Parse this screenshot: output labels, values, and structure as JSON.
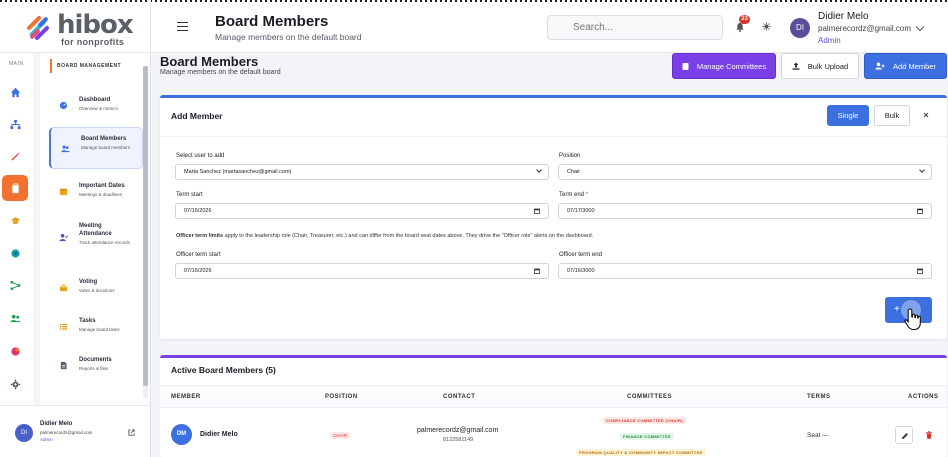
{
  "brand": {
    "name": "hibox",
    "tagline": "for nonprofits"
  },
  "header": {
    "title": "Board Members",
    "subtitle": "Manage members on the default board",
    "search_placeholder": "Search...",
    "notification_count": "33",
    "user": {
      "name": "Didier Melo",
      "email": "palmerecordz@gmail.com",
      "role": "Admin",
      "initials": "DI"
    }
  },
  "rail": {
    "label": "MAIN",
    "items": [
      "home-icon",
      "sitemap-icon",
      "rocket-icon",
      "clipboard-icon",
      "graduation-icon",
      "globe-icon",
      "network-icon",
      "users-icon",
      "chart-pie-icon",
      "gear-icon"
    ]
  },
  "sidebar": {
    "section": "BOARD MANAGEMENT",
    "items": [
      {
        "title": "Dashboard",
        "desc": "Overview & metrics"
      },
      {
        "title": "Board Members",
        "desc": "Manage board members"
      },
      {
        "title": "Important Dates",
        "desc": "Meetings & deadlines"
      },
      {
        "title": "Meeting Attendance",
        "desc": "Track attendance records"
      },
      {
        "title": "Voting",
        "desc": "Votes & decisions"
      },
      {
        "title": "Tasks",
        "desc": "Manage board tasks"
      },
      {
        "title": "Documents",
        "desc": "Reports & files"
      }
    ],
    "user": {
      "name": "Didier Melo",
      "email": "palmerecordz@gmail.com",
      "role": "Admin",
      "initials": "DI"
    }
  },
  "page": {
    "title": "Board Members",
    "subtitle": "Manage members on the default board",
    "actions": {
      "committees": "Manage Committees",
      "bulk_upload": "Bulk Upload",
      "add_member": "Add Member"
    }
  },
  "add_member": {
    "title": "Add Member",
    "mode_single": "Single",
    "mode_bulk": "Bulk",
    "select_user_label": "Select user to add",
    "select_user_value": "Marta Sanchez (martasanchez@gmail.com)",
    "position_label": "Position",
    "position_value": "Chair",
    "term_start_label": "Term start",
    "term_start_value": "07/16/2026",
    "term_end_label": "Term end",
    "term_end_required": "*",
    "term_end_value": "07/17/3000",
    "note_bold": "Officer term limits",
    "note_text": " apply to the leadership role (Chair, Treasurer, etc.) and can differ from the board seat dates above. They drive the \"Officer role\" alerts on the dashboard.",
    "officer_start_label": "Officer term start",
    "officer_start_value": "07/16/2026",
    "officer_end_label": "Officer term end",
    "officer_end_value": "07/16/3000",
    "save_label": "+"
  },
  "members": {
    "title": "Active Board Members (5)",
    "columns": [
      "MEMBER",
      "POSITION",
      "CONTACT",
      "COMMITTEES",
      "TERMS",
      "ACTIONS"
    ],
    "rows": [
      {
        "initials": "DM",
        "name": "Didier Melo",
        "position": "CHAIR",
        "email": "palmerecordz@gmail.com",
        "phone": "8122581149",
        "committees": [
          "COMPLIANCE COMMITTEE (CHAIR)",
          "FINANCE COMMITTEE",
          "PROGRAM QUALITY & COMMUNITY IMPACT COMMITTEE"
        ],
        "terms": "Seat —"
      }
    ]
  },
  "colors": {
    "primary": "#3c6fe0",
    "purple": "#7a3fe6",
    "orange": "#f2712f",
    "danger": "#d9342b"
  }
}
